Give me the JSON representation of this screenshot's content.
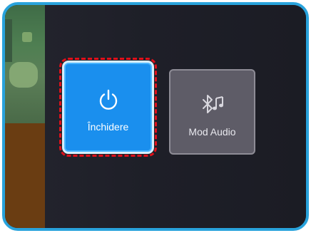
{
  "menu": {
    "tiles": [
      {
        "label": "Închidere",
        "icon": "power-icon",
        "state": "focused",
        "color": "#1a8fee"
      },
      {
        "label": "Mod Audio",
        "icon": "bluetooth-music-icon",
        "state": "default",
        "color": "#5e5c67"
      }
    ]
  },
  "colors": {
    "frame_border": "#29a3dc",
    "focus_outline": "#e0101a",
    "background": "#1c1d26"
  }
}
